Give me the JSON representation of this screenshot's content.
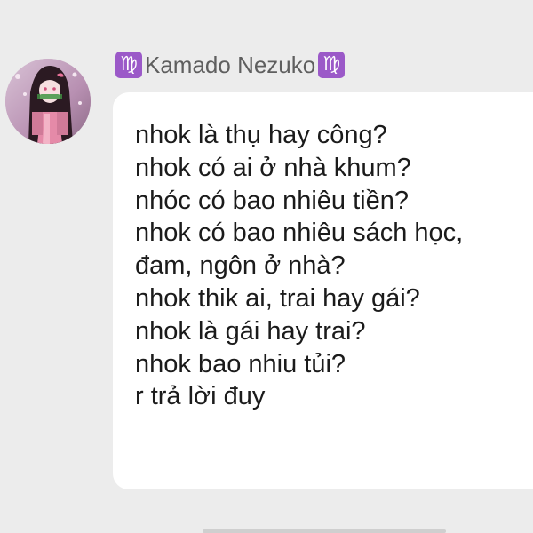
{
  "sender": {
    "name": "Kamado Nezuko",
    "zodiac_symbol": "♍"
  },
  "message": {
    "lines": [
      "nhok là thụ hay công?",
      "nhok có ai ở nhà khum?",
      "nhóc có bao nhiêu tiền?",
      "nhok có bao nhiêu sách học,",
      "đam, ngôn ở nhà?",
      "nhok thik ai, trai hay gái?",
      "nhok là gái hay trai?",
      "nhok bao nhiu tủi?",
      "r trả lời đuy"
    ]
  },
  "colors": {
    "background": "#ececec",
    "bubble": "#ffffff",
    "zodiac_badge": "#9b59c8",
    "sender_text": "#5f5f5f",
    "message_text": "#1b1b1b"
  }
}
